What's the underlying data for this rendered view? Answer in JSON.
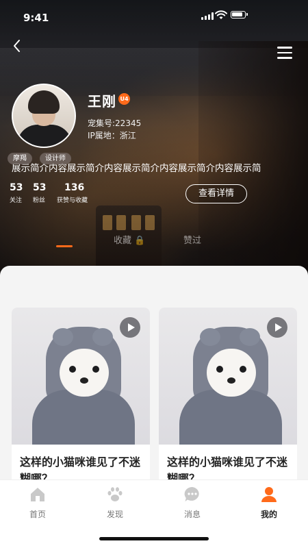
{
  "status_bar": {
    "time": "9:41"
  },
  "profile": {
    "name": "王刚",
    "level_badge": "U4",
    "pet_id": "宠集号:22345",
    "ip_location": "IP属地：浙江",
    "tags": [
      "摩羯",
      "设计师"
    ],
    "intro": "展示简介内容展示简介内容展示简介内容展示简介内容展示简",
    "stats": [
      {
        "value": "53",
        "label": "关注"
      },
      {
        "value": "53",
        "label": "粉丝"
      },
      {
        "value": "136",
        "label": "获赞与收藏"
      }
    ],
    "detail_button": "查看详情"
  },
  "tabs": [
    {
      "label": "",
      "active": true
    },
    {
      "label": "收藏 🔒",
      "active": false
    },
    {
      "label": "赞过",
      "active": false
    }
  ],
  "cards": [
    {
      "title": "这样的小猫咪谁见了不迷糊哪？",
      "has_video": true
    },
    {
      "title": "这样的小猫咪谁见了不迷糊哪？",
      "has_video": true
    }
  ],
  "bottom_nav": [
    {
      "label": "首页",
      "icon": "home-icon",
      "active": false
    },
    {
      "label": "发现",
      "icon": "paw-icon",
      "active": false
    },
    {
      "label": "消息",
      "icon": "message-icon",
      "active": false
    },
    {
      "label": "我的",
      "icon": "profile-icon",
      "active": true
    }
  ],
  "colors": {
    "accent": "#ff6a1a"
  }
}
